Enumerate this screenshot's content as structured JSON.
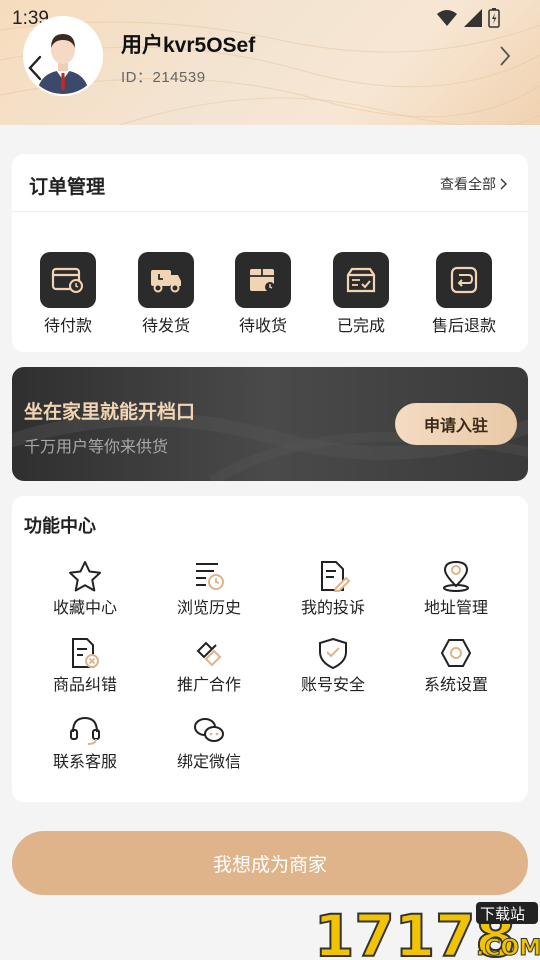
{
  "status_bar": {
    "time": "1:39"
  },
  "profile": {
    "username": "用户kvr5OSef",
    "id_label": "ID：214539"
  },
  "orders": {
    "title": "订单管理",
    "view_all": "查看全部",
    "items": [
      {
        "label": "待付款",
        "icon": "wallet-clock-icon"
      },
      {
        "label": "待发货",
        "icon": "truck-icon"
      },
      {
        "label": "待收货",
        "icon": "package-clock-icon"
      },
      {
        "label": "已完成",
        "icon": "box-check-icon"
      },
      {
        "label": "售后退款",
        "icon": "refund-icon"
      }
    ]
  },
  "banner": {
    "title": "坐在家里就能开档口",
    "subtitle": "千万用户等你来供货",
    "button": "申请入驻"
  },
  "functions": {
    "title": "功能中心",
    "items": [
      {
        "label": "收藏中心",
        "icon": "star-icon"
      },
      {
        "label": "浏览历史",
        "icon": "history-icon"
      },
      {
        "label": "我的投诉",
        "icon": "complaint-icon"
      },
      {
        "label": "地址管理",
        "icon": "location-icon"
      },
      {
        "label": "商品纠错",
        "icon": "doc-error-icon"
      },
      {
        "label": "推广合作",
        "icon": "handshake-icon"
      },
      {
        "label": "账号安全",
        "icon": "shield-icon"
      },
      {
        "label": "系统设置",
        "icon": "hexagon-settings-icon"
      },
      {
        "label": "联系客服",
        "icon": "headset-icon"
      },
      {
        "label": "绑定微信",
        "icon": "wechat-icon"
      }
    ]
  },
  "merchant_button": "我想成为商家",
  "watermark": {
    "text": "17178",
    "tag": "下载站",
    "domain": ".COM"
  },
  "colors": {
    "accent": "#dfb48a",
    "dark_icon_bg": "#2b2b2b",
    "banner_title": "#f1d4b3"
  }
}
